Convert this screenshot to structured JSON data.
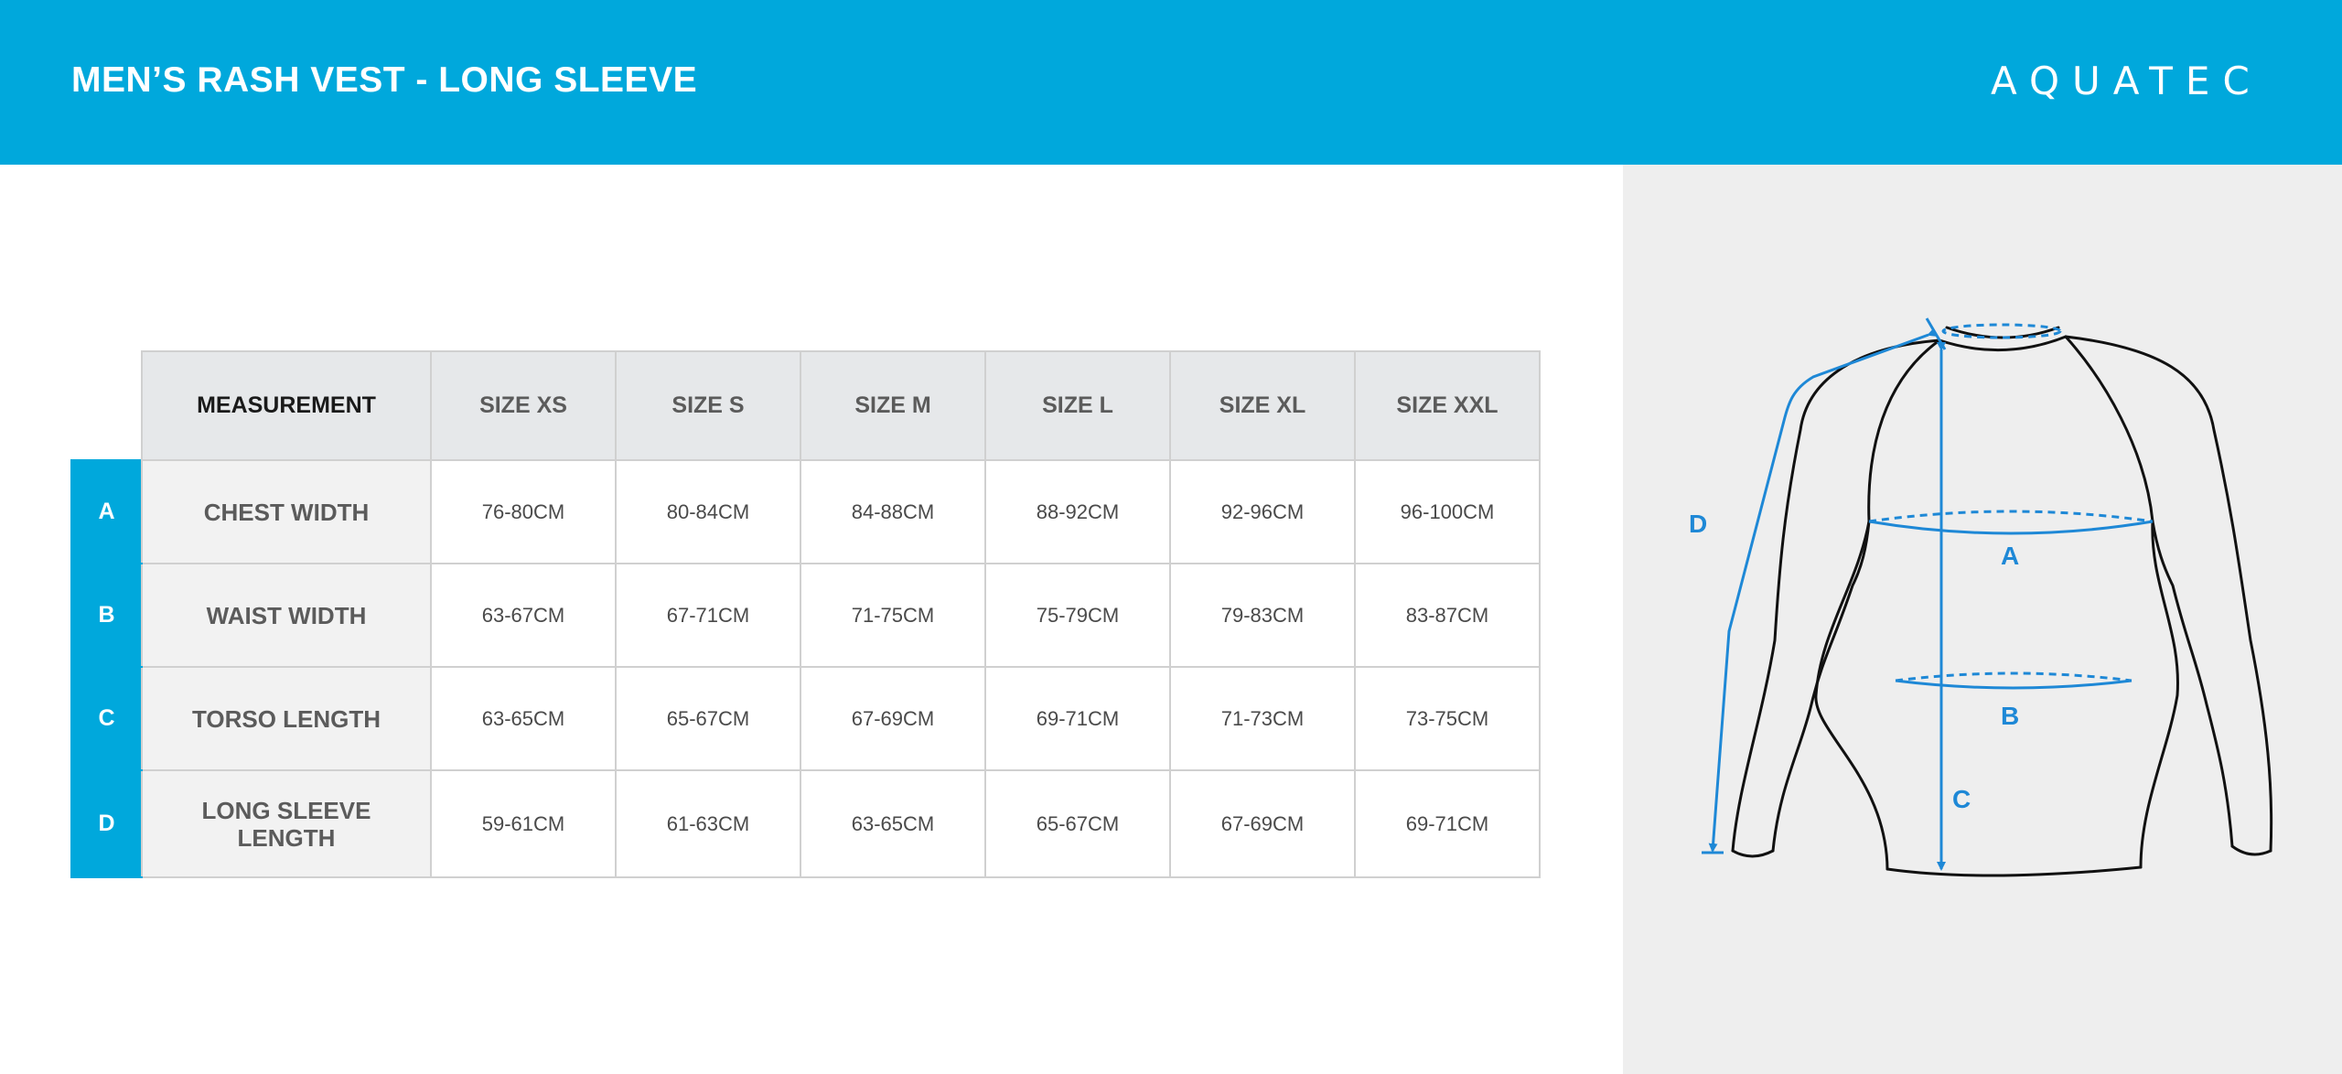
{
  "header": {
    "title": "MEN’S RASH VEST - LONG SLEEVE",
    "brand": "AQUATEC",
    "background_color": "#00a8dc"
  },
  "table": {
    "columns": [
      "MEASUREMENT",
      "SIZE XS",
      "SIZE S",
      "SIZE M",
      "SIZE L",
      "SIZE XL",
      "SIZE XXL"
    ],
    "rows": [
      {
        "letter": "A",
        "name": "CHEST WIDTH",
        "values": [
          "76-80CM",
          "80-84CM",
          "84-88CM",
          "88-92CM",
          "92-96CM",
          "96-100CM"
        ]
      },
      {
        "letter": "B",
        "name": "WAIST WIDTH",
        "values": [
          "63-67CM",
          "67-71CM",
          "71-75CM",
          "75-79CM",
          "79-83CM",
          "83-87CM"
        ]
      },
      {
        "letter": "C",
        "name": "TORSO LENGTH",
        "values": [
          "63-65CM",
          "65-67CM",
          "67-69CM",
          "69-71CM",
          "71-73CM",
          "73-75CM"
        ]
      },
      {
        "letter": "D",
        "name": "LONG SLEEVE LENGTH",
        "values": [
          "59-61CM",
          "61-63CM",
          "63-65CM",
          "65-67CM",
          "67-69CM",
          "69-71CM"
        ]
      }
    ]
  },
  "diagram": {
    "labels": {
      "a": "A",
      "b": "B",
      "c": "C",
      "d": "D"
    },
    "measure_color": "#1e88d6"
  }
}
